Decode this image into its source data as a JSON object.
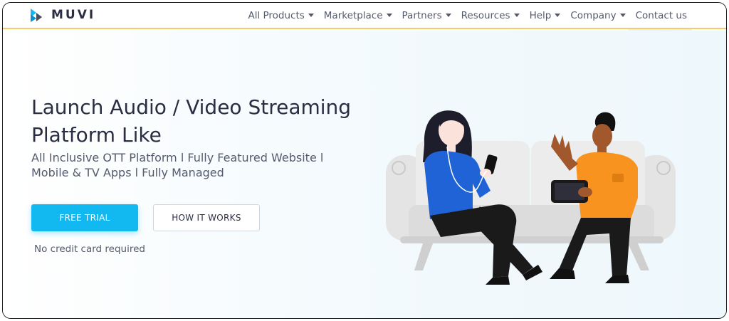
{
  "brand": {
    "name": "MUVI",
    "logo_icon": "muvi-logo-icon",
    "accent": "#12b8f0"
  },
  "nav": {
    "items": [
      {
        "label": "All Products",
        "dropdown": true
      },
      {
        "label": "Marketplace",
        "dropdown": true
      },
      {
        "label": "Partners",
        "dropdown": true
      },
      {
        "label": "Resources",
        "dropdown": true
      },
      {
        "label": "Help",
        "dropdown": true
      },
      {
        "label": "Company",
        "dropdown": true
      },
      {
        "label": "Contact us",
        "dropdown": false
      }
    ]
  },
  "hero": {
    "headline_line1": "Launch Audio / Video Streaming",
    "headline_line2": "Platform Like",
    "subline_line1": "All Inclusive OTT Platform l Fully Featured Website l",
    "subline_line2": "Mobile & TV Apps l Fully Managed",
    "primary_cta": "FREE TRIAL",
    "secondary_cta": "HOW IT WORKS",
    "note": "No credit card required"
  },
  "colors": {
    "header_border": "#f3c96a",
    "text_dark": "#2b2d42",
    "text_muted": "#555b6e",
    "shirt_blue": "#1f63d6",
    "shirt_orange": "#f7931e",
    "sofa": "#e4e4e4"
  }
}
